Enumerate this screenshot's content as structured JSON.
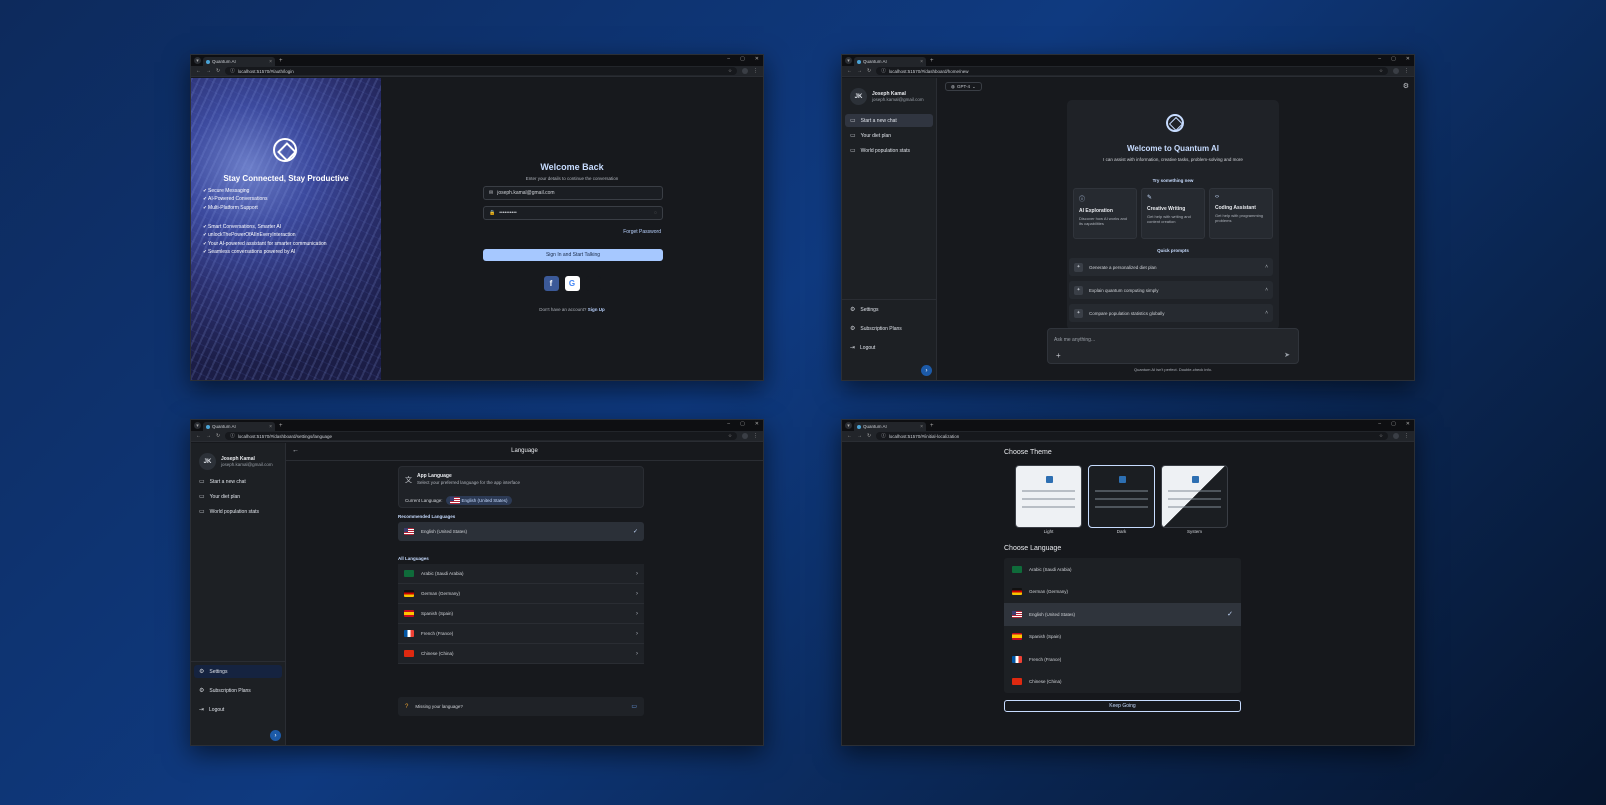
{
  "browser": {
    "tab_title": "Quantum AI",
    "urls": {
      "login": "localhost:51570/#/auth/login",
      "home": "localhost:51570/#/dashboard/home/new",
      "language": "localhost:51570/#/dashboard/settings/language",
      "initial": "localhost:51570/#/initial-localization"
    }
  },
  "login": {
    "hero_title": "Stay Connected, Stay Productive",
    "features_1": [
      "Secure Messaging",
      "AI-Powered Conversations",
      "Multi-Platform Support"
    ],
    "features_2": [
      "Smart Conversations, Smarter AI",
      "unlockThePowerOfAIInEveryInteraction",
      "Your AI-powered assistant for smarter communication",
      "Seamless conversations powered by AI"
    ],
    "title": "Welcome Back",
    "subtitle": "Enter your details to continue the conversation",
    "email_value": "joseph.kamal@gmail.com",
    "password_value": "••••••••••",
    "forgot": "Forget Password",
    "sign_in": "Sign In and Start Talking",
    "no_account": "Don't have an account?",
    "sign_up": "Sign Up"
  },
  "user": {
    "initials": "JK",
    "name": "Joseph Kamal",
    "email": "joseph.kamal@gmail.com"
  },
  "sidebar": {
    "items": [
      "Start a new chat",
      "Your diet plan",
      "World population stats"
    ],
    "settings": "Settings",
    "subscription": "Subscription Plans",
    "logout": "Logout"
  },
  "home": {
    "model": "GPT-4",
    "welcome_title": "Welcome to Quantum AI",
    "welcome_sub": "I can assist with information, creative tasks, problem-solving and more",
    "try_new": "Try something new",
    "cards": [
      {
        "title": "AI Exploration",
        "desc": "Discover how AI works and its capabilities"
      },
      {
        "title": "Creative Writing",
        "desc": "Get help with writing and content creation"
      },
      {
        "title": "Coding Assistant",
        "desc": "Get help with programming problems"
      }
    ],
    "quick_prompts_label": "Quick prompts",
    "prompts": [
      "Generate a personalized diet plan",
      "Explain quantum computing simply",
      "Compare population statistics globally"
    ],
    "ask_placeholder": "Ask me anything...",
    "disclaimer": "Quantum AI isn't perfect. Double-check info."
  },
  "language_page": {
    "title": "Language",
    "app_language": "App Language",
    "app_language_sub": "Select your preferred language for the app interface",
    "current_label": "Current Language:",
    "current_value": "English (United States)",
    "recommended_label": "Recommended Languages",
    "all_label": "All Languages",
    "missing": "Missing your language?"
  },
  "languages": {
    "arabic": "Arabic (Saudi Arabia)",
    "german": "German (Germany)",
    "english": "English (United States)",
    "spanish": "Spanish (Spain)",
    "french": "French (France)",
    "chinese": "Chinese (China)"
  },
  "onboarding": {
    "choose_theme": "Choose Theme",
    "themes": [
      "Light",
      "Dark",
      "System"
    ],
    "choose_language": "Choose Language",
    "keep_going": "Keep Going"
  }
}
